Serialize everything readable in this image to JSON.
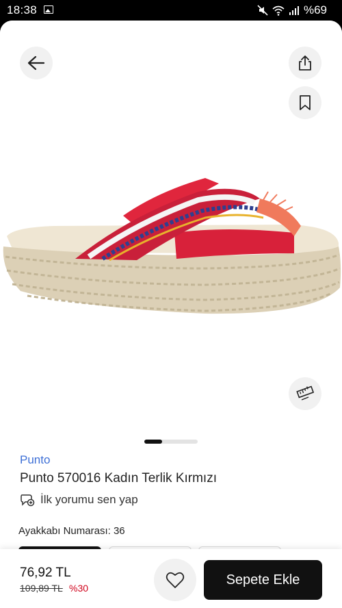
{
  "status": {
    "time": "18:38",
    "battery": "%69"
  },
  "product": {
    "brand": "Punto",
    "title": "Punto 570016 Kadın Terlik Kırmızı",
    "review_prompt": "İlk yorumu sen yap",
    "size_label": "Ayakkabı Numarası:",
    "size_value": "36"
  },
  "pricing": {
    "price": "76,92 TL",
    "old_price": "109,89 TL",
    "discount": "%30"
  },
  "actions": {
    "add_to_cart": "Sepete Ekle"
  },
  "gallery": {
    "image_count": 3,
    "active_index": 1
  },
  "colors": {
    "brand_link": "#3d6fd6",
    "discount": "#d0021b",
    "primary_button": "#111111"
  },
  "icons": [
    "back-arrow-icon",
    "share-icon",
    "bookmark-icon",
    "size-guide-ruler-icon",
    "review-add-icon",
    "heart-icon"
  ]
}
